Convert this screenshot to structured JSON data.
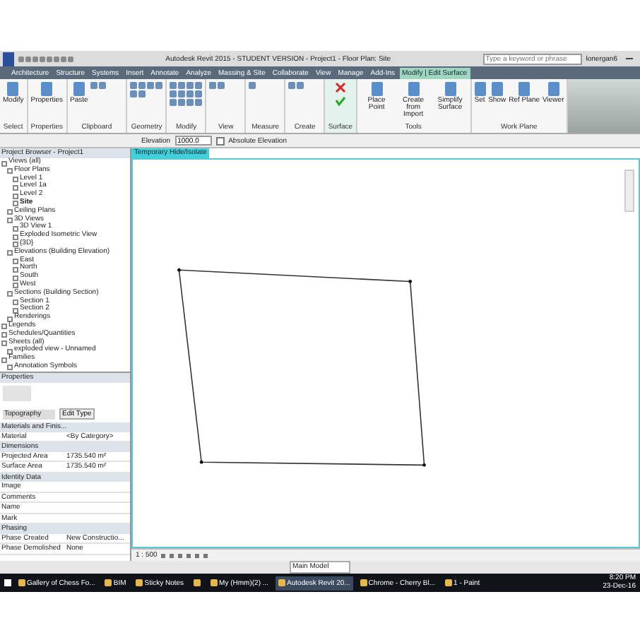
{
  "window": {
    "title": "Autodesk Revit 2015 - STUDENT VERSION -   Project1 - Floor Plan: Site"
  },
  "search": {
    "placeholder": "Type a keyword or phrase"
  },
  "user": "lonergan6",
  "tabs": [
    {
      "label": "Architecture",
      "selected": false
    },
    {
      "label": "Structure",
      "selected": false
    },
    {
      "label": "Systems",
      "selected": false
    },
    {
      "label": "Insert",
      "selected": false
    },
    {
      "label": "Annotate",
      "selected": false
    },
    {
      "label": "Analyze",
      "selected": false
    },
    {
      "label": "Massing & Site",
      "selected": false
    },
    {
      "label": "Collaborate",
      "selected": false
    },
    {
      "label": "View",
      "selected": false
    },
    {
      "label": "Manage",
      "selected": false
    },
    {
      "label": "Add-Ins",
      "selected": false
    },
    {
      "label": "Modify | Edit Surface",
      "selected": true
    }
  ],
  "panels": [
    {
      "name": "Select",
      "kind": "select",
      "buttons": [
        "Modify"
      ]
    },
    {
      "name": "Properties",
      "kind": "properties",
      "buttons": [
        "Properties"
      ]
    },
    {
      "name": "Clipboard",
      "kind": "clipboard",
      "buttons": [
        "Paste"
      ]
    },
    {
      "name": "Geometry",
      "kind": "geometry"
    },
    {
      "name": "Modify",
      "kind": "modify"
    },
    {
      "name": "View",
      "kind": "view"
    },
    {
      "name": "Measure",
      "kind": "measure"
    },
    {
      "name": "Create",
      "kind": "create"
    },
    {
      "name": "Surface",
      "kind": "surface"
    },
    {
      "name": "Tools",
      "kind": "tools",
      "buttons": [
        "Place Point",
        "Create from Import",
        "Simplify Surface"
      ]
    },
    {
      "name": "Work Plane",
      "kind": "workplane",
      "buttons": [
        "Set",
        "Show",
        "Ref Plane",
        "Viewer"
      ]
    }
  ],
  "options_bar": {
    "label": "Elevation",
    "value": "1000.0",
    "checkbox_label": "Absolute Elevation",
    "checked": false
  },
  "project_browser": {
    "title": "Project Browser - Project1",
    "tree": [
      {
        "label": "Views (all)",
        "selected": false,
        "children": [
          {
            "label": "Floor Plans",
            "selected": false,
            "children": [
              {
                "label": "Level 1",
                "selected": false
              },
              {
                "label": "Level 1a",
                "selected": false
              },
              {
                "label": "Level 2",
                "selected": false
              },
              {
                "label": "Site",
                "selected": true
              }
            ]
          },
          {
            "label": "Ceiling Plans",
            "selected": false
          },
          {
            "label": "3D Views",
            "selected": false,
            "children": [
              {
                "label": "3D View 1",
                "selected": false
              },
              {
                "label": "Exploded Isometric View",
                "selected": false
              },
              {
                "label": "{3D}",
                "selected": false
              }
            ]
          },
          {
            "label": "Elevations (Building Elevation)",
            "selected": false,
            "children": [
              {
                "label": "East",
                "selected": false
              },
              {
                "label": "North",
                "selected": false
              },
              {
                "label": "South",
                "selected": false
              },
              {
                "label": "West",
                "selected": false
              }
            ]
          },
          {
            "label": "Sections (Building Section)",
            "selected": false,
            "children": [
              {
                "label": "Section 1",
                "selected": false
              },
              {
                "label": "Section 2",
                "selected": false
              }
            ]
          },
          {
            "label": "Renderings",
            "selected": false
          }
        ]
      },
      {
        "label": "Legends",
        "selected": false
      },
      {
        "label": "Schedules/Quantities",
        "selected": false
      },
      {
        "label": "Sheets (all)",
        "selected": false,
        "children": [
          {
            "label": "exploded view - Unnamed",
            "selected": false
          }
        ]
      },
      {
        "label": "Families",
        "selected": false,
        "children": [
          {
            "label": "Annotation Symbols",
            "selected": false
          }
        ]
      }
    ]
  },
  "properties": {
    "title": "Properties",
    "type_name": "Topography",
    "edit_type": "Edit Type",
    "sections": [
      {
        "name": "Materials and Finis...",
        "rows": [
          {
            "label": "Material",
            "value": "<By Category>"
          }
        ]
      },
      {
        "name": "Dimensions",
        "rows": [
          {
            "label": "Projected Area",
            "value": "1735.540 m²"
          },
          {
            "label": "Surface Area",
            "value": "1735.540 m²"
          }
        ]
      },
      {
        "name": "Identity Data",
        "rows": [
          {
            "label": "Image"
          },
          {
            "label": "Comments"
          },
          {
            "label": "Name"
          },
          {
            "label": "Mark"
          }
        ]
      },
      {
        "name": "Phasing",
        "rows": [
          {
            "label": "Phase Created",
            "value": "New Constructio..."
          },
          {
            "label": "Phase Demolished",
            "value": "None"
          }
        ]
      }
    ]
  },
  "view": {
    "tab": "Temporary Hide/Isolate",
    "scale": "1 : 500"
  },
  "status_bar": {
    "model": "Main Model"
  },
  "taskbar": {
    "items": [
      {
        "label": "Gallery of Chess Fo...",
        "selected": false
      },
      {
        "label": "BIM",
        "selected": false
      },
      {
        "label": "Sticky Notes",
        "selected": false
      },
      {
        "selected": false
      },
      {
        "label": "My (Hmm)(2) ...",
        "selected": false
      },
      {
        "label": "Autodesk Revit 20...",
        "selected": true
      },
      {
        "label": "Chrome - Cherry Bl...",
        "selected": false
      },
      {
        "label": "1 - Paint",
        "selected": false
      }
    ],
    "time": "8:20 PM",
    "date": "23-Dec-16"
  }
}
